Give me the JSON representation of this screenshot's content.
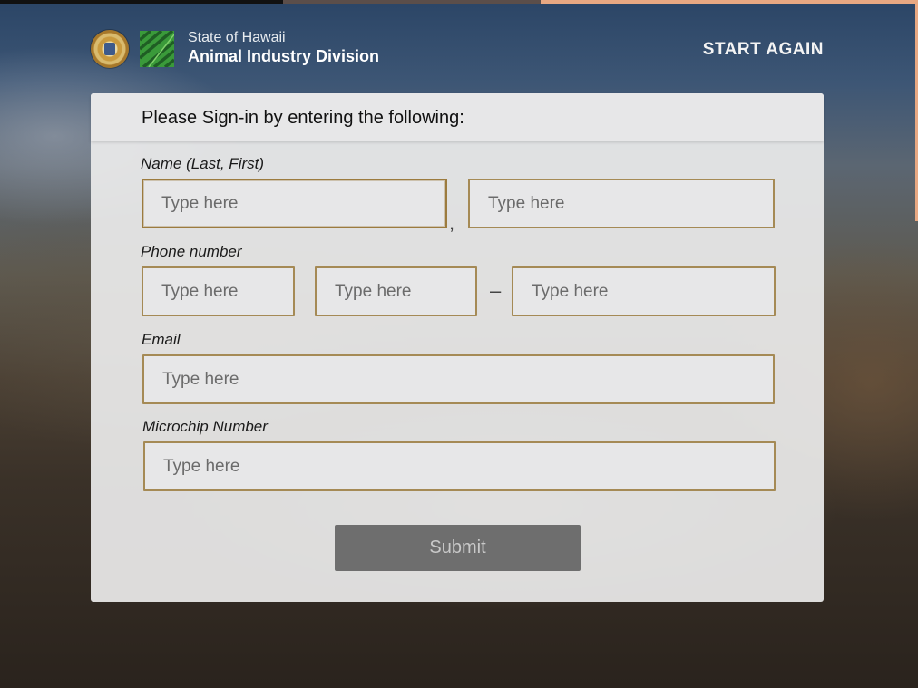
{
  "header": {
    "brand_line1": "State of Hawaii",
    "brand_line2": "Animal Industry Division",
    "start_again": "START AGAIN"
  },
  "form": {
    "title": "Please Sign-in by entering the following:",
    "name_label": "Name (Last, First)",
    "name_separator": ",",
    "phone_label": "Phone number",
    "phone_separator": "–",
    "email_label": "Email",
    "microchip_label": "Microchip Number",
    "placeholder": "Type here",
    "submit_label": "Submit"
  },
  "colors": {
    "input_border": "#a58a55",
    "submit_bg": "#6e6e6e",
    "panel_bg": "#ebebec"
  },
  "icons": {
    "seal": "state-seal-icon",
    "division": "animal-industry-logo-icon"
  }
}
